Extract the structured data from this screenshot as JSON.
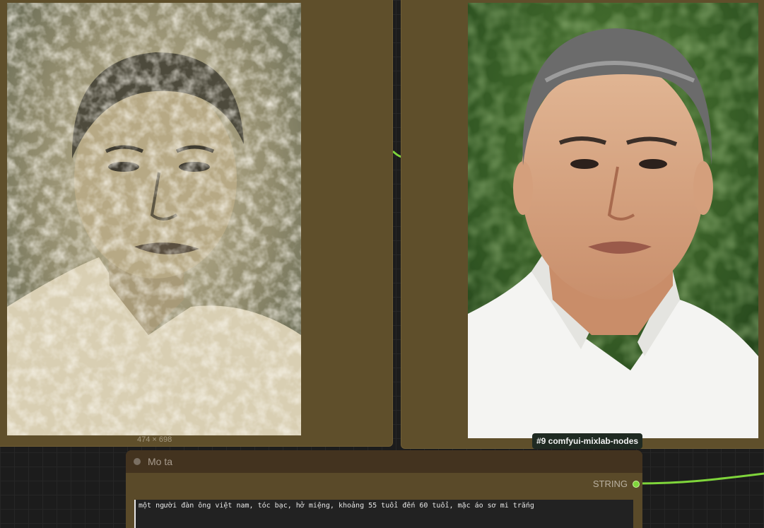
{
  "left_node": {
    "image_dims": "474 × 698"
  },
  "right_node": {
    "badge": "#9 comfyui-mixlab-nodes"
  },
  "mota_node": {
    "title": "Mo ta",
    "output_label": "STRING",
    "text_value": "một người đàn ông việt nam, tóc bạc, hở miệng, khoảng 55 tuổi đến 60 tuổi, mặc áo sơ mi trắng"
  },
  "colors": {
    "wire": "#7fd53b",
    "node_body": "#5f4f2b",
    "node_header": "#43331f"
  }
}
